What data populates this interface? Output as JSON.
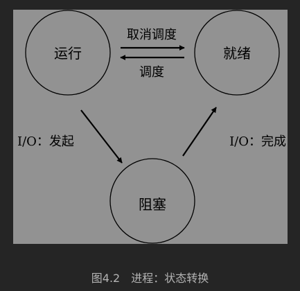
{
  "states": {
    "running": "运行",
    "ready": "就绪",
    "blocked": "阻塞"
  },
  "transitions": {
    "cancel_schedule": "取消调度",
    "schedule": "调度",
    "io_start": "I/O：发起",
    "io_done": "I/O：完成"
  },
  "caption": "图4.2　进程：状态转换"
}
